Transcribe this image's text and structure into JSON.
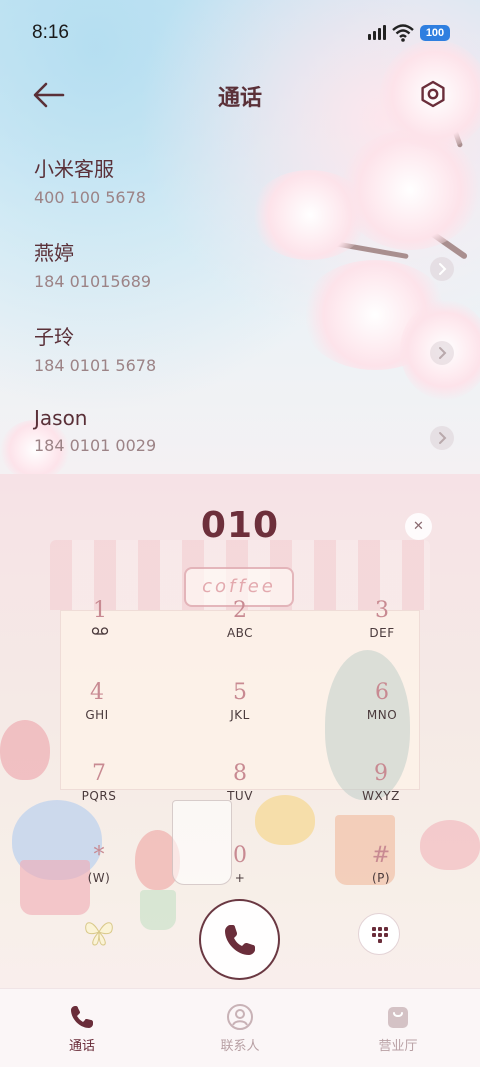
{
  "status_bar": {
    "time": "8:16",
    "battery": "100"
  },
  "header": {
    "title": "通话",
    "back_icon": "arrow-left-icon",
    "settings_icon": "gear-icon"
  },
  "contacts": [
    {
      "name": "小米客服",
      "number": "400 100 5678"
    },
    {
      "name": "燕婷",
      "number": "184 01015689"
    },
    {
      "name": "子玲",
      "number": "184 0101 5678"
    },
    {
      "name": "Jason",
      "number": "184 0101 0029"
    }
  ],
  "dialer": {
    "input": "010",
    "keys": [
      {
        "digit": "1",
        "letters": ""
      },
      {
        "digit": "2",
        "letters": "ABC"
      },
      {
        "digit": "3",
        "letters": "DEF"
      },
      {
        "digit": "4",
        "letters": "GHI"
      },
      {
        "digit": "5",
        "letters": "JKL"
      },
      {
        "digit": "6",
        "letters": "MNO"
      },
      {
        "digit": "7",
        "letters": "PQRS"
      },
      {
        "digit": "8",
        "letters": "TUV"
      },
      {
        "digit": "9",
        "letters": "WXYZ"
      },
      {
        "digit": "*",
        "letters": "(W)"
      },
      {
        "digit": "0",
        "letters": "+"
      },
      {
        "digit": "#",
        "letters": "(P)"
      }
    ]
  },
  "tabs": [
    {
      "label": "通话",
      "icon": "phone-icon",
      "active": true
    },
    {
      "label": "联系人",
      "icon": "person-icon",
      "active": false
    },
    {
      "label": "营业厅",
      "icon": "shopping-bag-icon",
      "active": false
    }
  ],
  "colors": {
    "accent": "#6a2d3a",
    "secondary_text": "#9c8386",
    "key_digit": "#c88a92"
  }
}
